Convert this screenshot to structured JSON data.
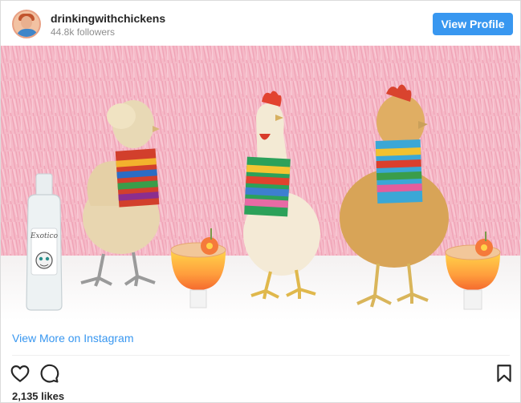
{
  "header": {
    "username": "drinkingwithchickens",
    "followers": "44.8k followers",
    "view_profile_label": "View Profile"
  },
  "photo": {
    "bottle_label": "Exotico"
  },
  "footer": {
    "view_more_label": "View More on Instagram",
    "likes": "2,135 likes"
  },
  "icons": {
    "avatar": "profile-avatar",
    "like": "heart-icon",
    "comment": "comment-icon",
    "save": "bookmark-icon"
  },
  "colors": {
    "accent": "#3897f0",
    "text": "#262626",
    "muted": "#8e8e8e",
    "background_fringe": "#f3b7c7"
  }
}
